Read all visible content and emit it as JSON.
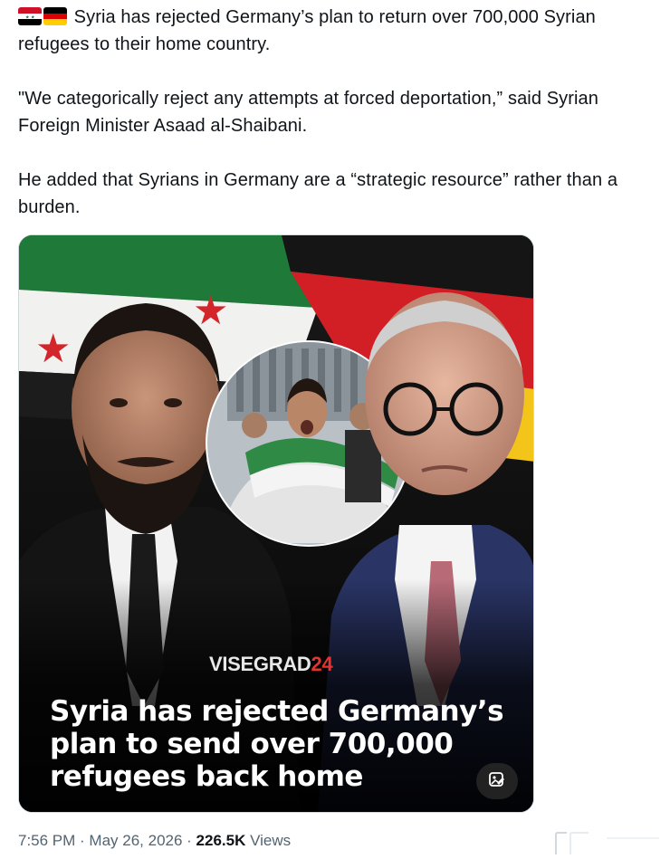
{
  "tweet": {
    "paragraph1": "Syria has rejected Germany’s plan to return over 700,000 Syrian refugees to their home country.",
    "paragraph2": "\"We categorically reject any attempts at forced deportation,” said Syrian Foreign Minister Asaad al-Shaibani.",
    "paragraph3": "He added that Syrians in Germany are a “strategic resource” rather than a burden.",
    "flags": [
      "syria-flag-icon",
      "germany-flag-icon"
    ]
  },
  "media": {
    "brand_main": "VISEGRAD",
    "brand_num": "24",
    "headline": "Syria has rejected Germany’s plan to send over 700,000 refugees back home",
    "alt_icon": "edit-image-icon"
  },
  "meta": {
    "time": "7:56 PM",
    "sep": " · ",
    "date": "May 26, 2026",
    "views_count": "226.5K",
    "views_label": " Views"
  },
  "colors": {
    "text": "#0f1419",
    "muted": "#536471",
    "brand_accent": "#e3342f"
  }
}
